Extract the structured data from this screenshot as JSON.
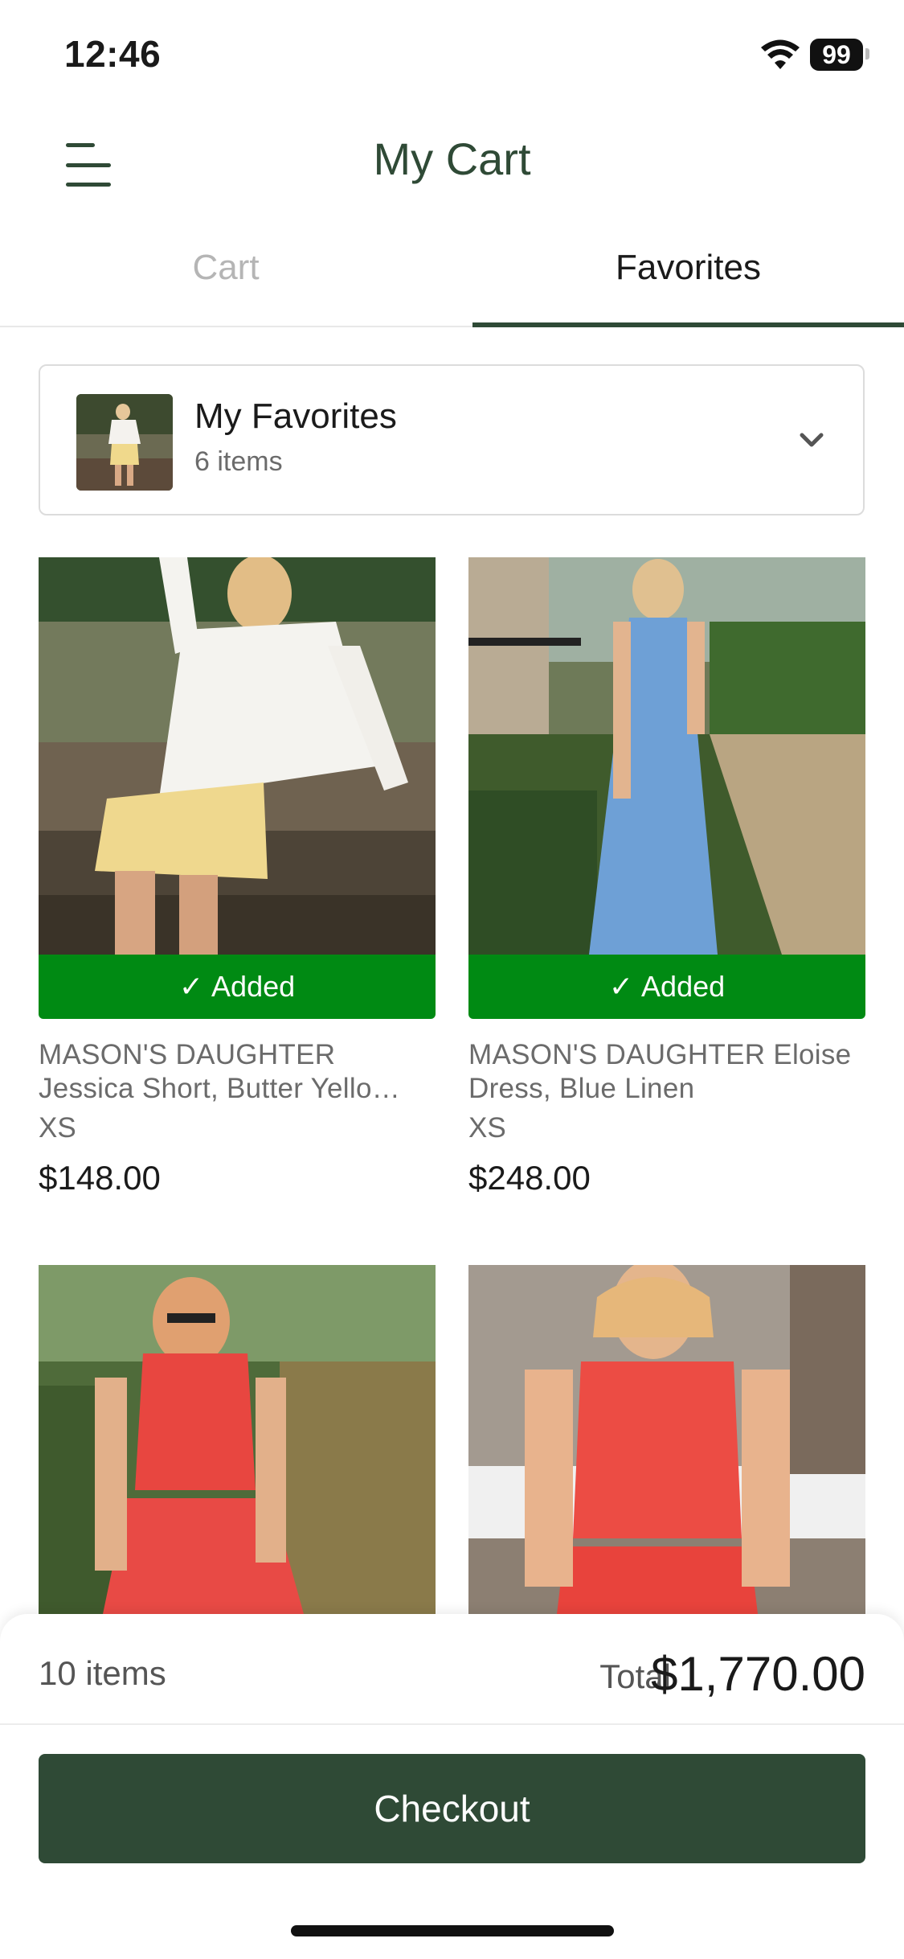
{
  "status_bar": {
    "time": "12:46",
    "battery": "99"
  },
  "header": {
    "title": "My Cart"
  },
  "tabs": [
    {
      "label": "Cart",
      "active": false
    },
    {
      "label": "Favorites",
      "active": true
    }
  ],
  "favorites_list": {
    "title": "My Favorites",
    "count": "6 items"
  },
  "products": [
    {
      "brand_line": "MASON'S DAUGHTER",
      "name_line": "Jessica Short, Butter Yello…",
      "size": "XS",
      "price": "$148.00",
      "added_label": "Added",
      "check": "✓"
    },
    {
      "brand_line": "MASON'S DAUGHTER Eloise",
      "name_line": "Dress, Blue Linen",
      "size": "XS",
      "price": "$248.00",
      "added_label": "Added",
      "check": "✓"
    }
  ],
  "summary": {
    "items": "10 items",
    "total_label": "Total",
    "total_value": "$1,770.00"
  },
  "checkout": {
    "label": "Checkout"
  },
  "colors": {
    "brand": "#2f4a36",
    "added": "#008a13",
    "muted": "#6b6b6b"
  },
  "icons": [
    "menu-icon",
    "chevron-down-icon",
    "wifi-icon",
    "battery-icon",
    "check-icon"
  ]
}
